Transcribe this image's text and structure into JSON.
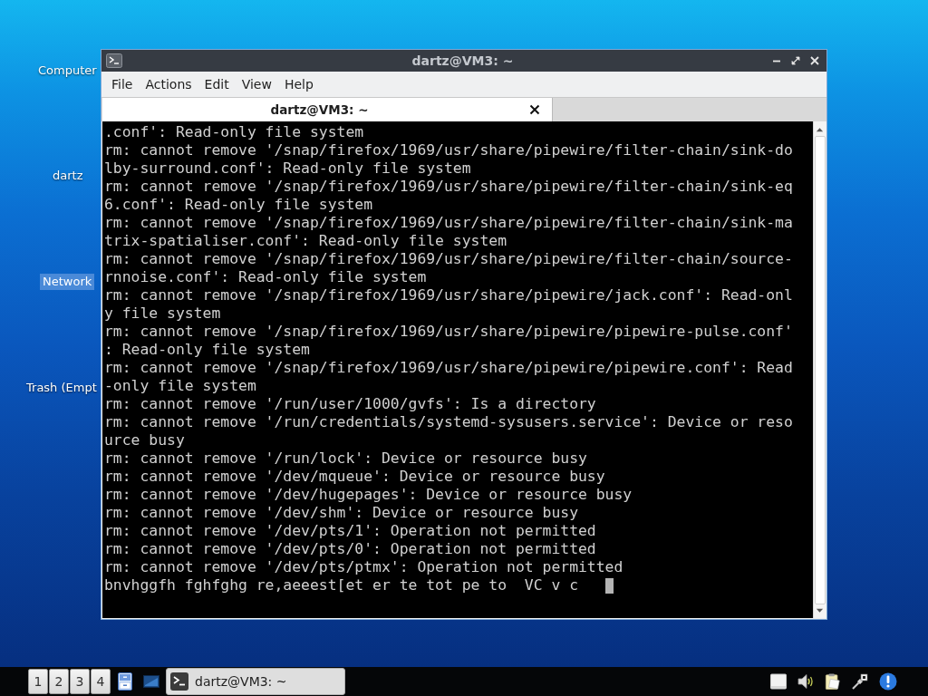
{
  "desktop": {
    "icons": [
      {
        "label": "Computer",
        "selected": false
      },
      {
        "label": "dartz",
        "selected": false
      },
      {
        "label": "Network",
        "selected": true
      },
      {
        "label": "Trash (Empt",
        "selected": false
      }
    ]
  },
  "window": {
    "title": "dartz@VM3: ~"
  },
  "menu": [
    "File",
    "Actions",
    "Edit",
    "View",
    "Help"
  ],
  "tabs": [
    {
      "label": "dartz@VM3: ~",
      "selected": true
    }
  ],
  "terminal": {
    "lines": [
      ".conf': Read-only file system",
      "rm: cannot remove '/snap/firefox/1969/usr/share/pipewire/filter-chain/sink-do",
      "lby-surround.conf': Read-only file system",
      "rm: cannot remove '/snap/firefox/1969/usr/share/pipewire/filter-chain/sink-eq",
      "6.conf': Read-only file system",
      "rm: cannot remove '/snap/firefox/1969/usr/share/pipewire/filter-chain/sink-ma",
      "trix-spatialiser.conf': Read-only file system",
      "rm: cannot remove '/snap/firefox/1969/usr/share/pipewire/filter-chain/source-",
      "rnnoise.conf': Read-only file system",
      "rm: cannot remove '/snap/firefox/1969/usr/share/pipewire/jack.conf': Read-onl",
      "y file system",
      "rm: cannot remove '/snap/firefox/1969/usr/share/pipewire/pipewire-pulse.conf'",
      ": Read-only file system",
      "rm: cannot remove '/snap/firefox/1969/usr/share/pipewire/pipewire.conf': Read",
      "-only file system",
      "rm: cannot remove '/run/user/1000/gvfs': Is a directory",
      "rm: cannot remove '/run/credentials/systemd-sysusers.service': Device or reso",
      "urce busy",
      "rm: cannot remove '/run/lock': Device or resource busy",
      "rm: cannot remove '/dev/mqueue': Device or resource busy",
      "rm: cannot remove '/dev/hugepages': Device or resource busy",
      "rm: cannot remove '/dev/shm': Device or resource busy",
      "rm: cannot remove '/dev/pts/1': Operation not permitted",
      "rm: cannot remove '/dev/pts/0': Operation not permitted",
      "rm: cannot remove '/dev/pts/ptmx': Operation not permitted"
    ],
    "input": "bnvhggfh fghfghg re,aeeest[et er te tot pe to  VC v c"
  },
  "taskbar": {
    "workspaces": [
      "1",
      "2",
      "3",
      "4"
    ],
    "tasks": [
      {
        "label": "dartz@VM3: ~"
      }
    ]
  }
}
